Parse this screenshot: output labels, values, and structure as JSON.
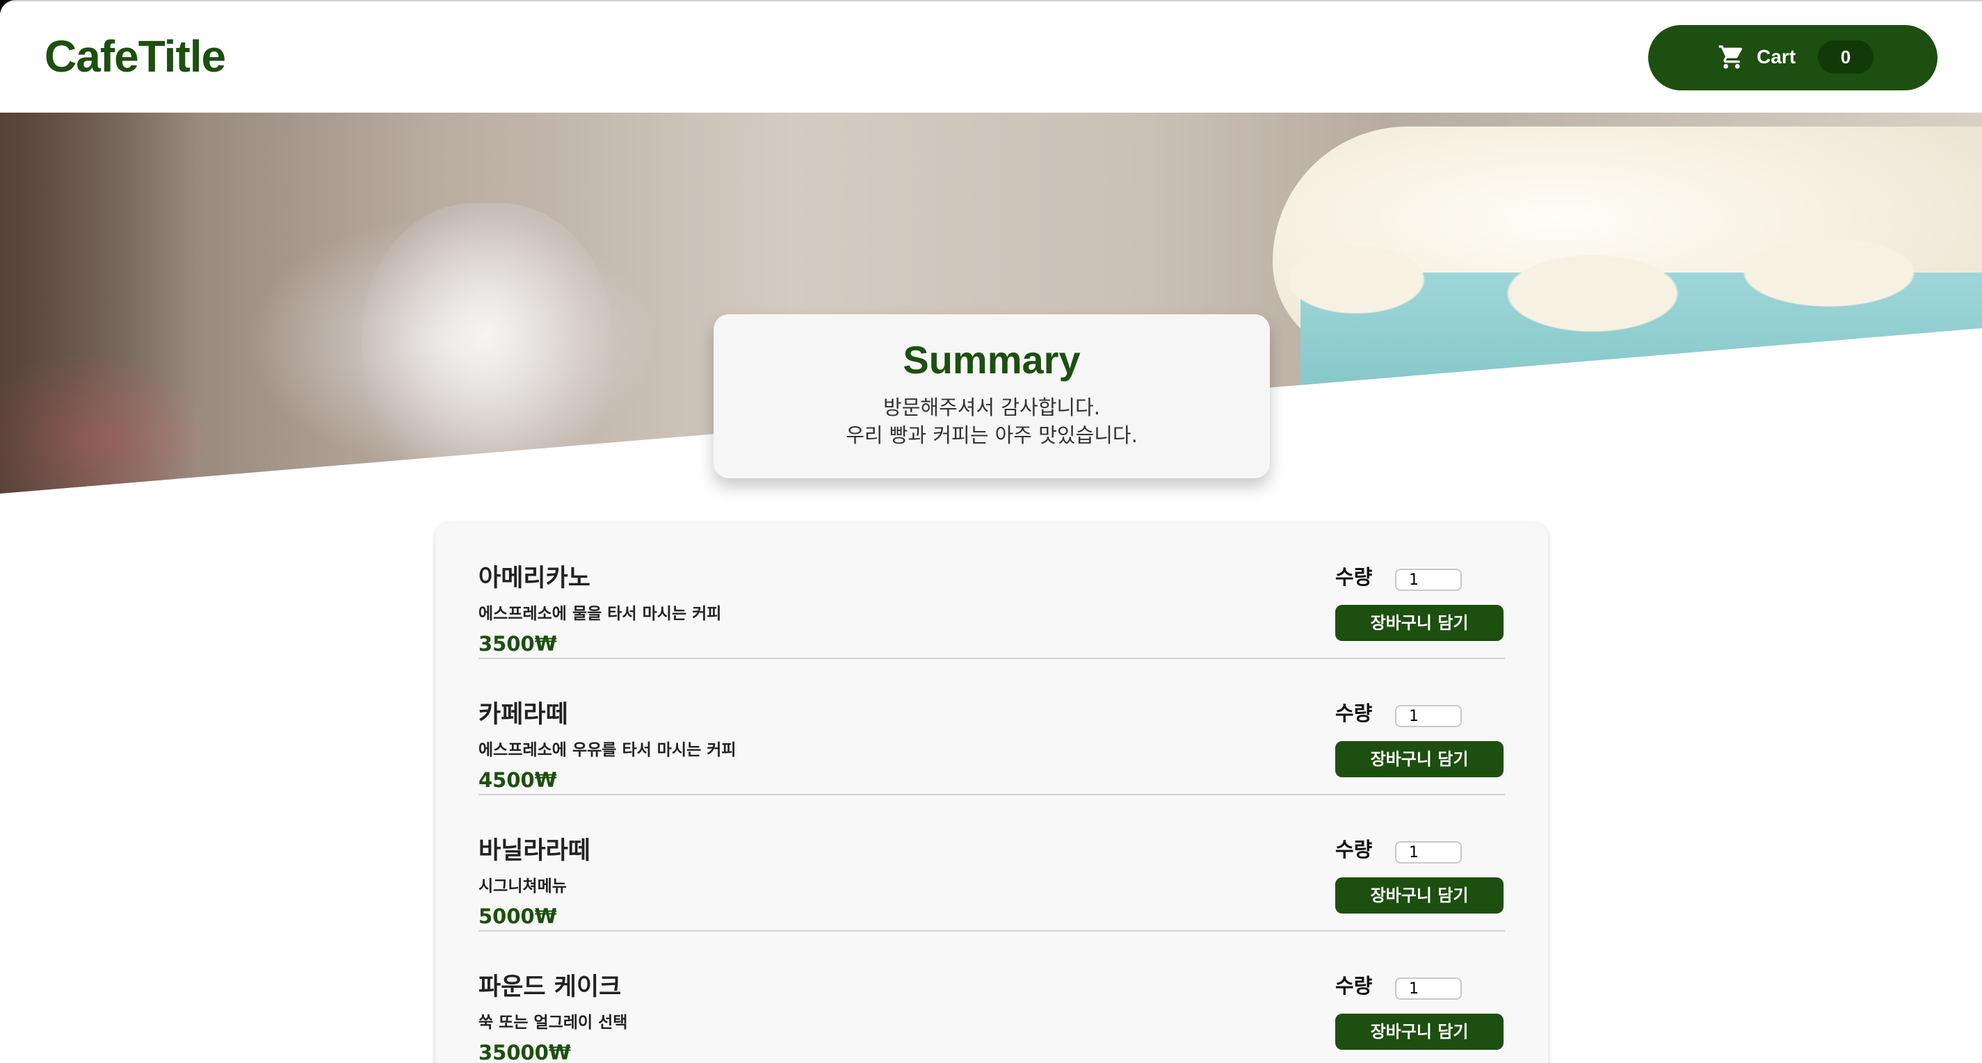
{
  "header": {
    "logo": "CafeTitle",
    "cart_label": "Cart",
    "cart_count": "0"
  },
  "summary": {
    "title": "Summary",
    "line1": "방문해주셔서 감사합니다.",
    "line2": "우리 빵과 커피는 아주 맛있습니다."
  },
  "menu": {
    "items": [
      {
        "name": "아메리카노",
        "description": "에스프레소에 물을 타서 마시는 커피",
        "price": "3500₩",
        "qty_label": "수량",
        "qty_value": "1",
        "button": "장바구니 담기"
      },
      {
        "name": "카페라떼",
        "description": "에스프레소에 우유를 타서 마시는 커피",
        "price": "4500₩",
        "qty_label": "수량",
        "qty_value": "1",
        "button": "장바구니 담기"
      },
      {
        "name": "바닐라라떼",
        "description": "시그니쳐메뉴",
        "price": "5000₩",
        "qty_label": "수량",
        "qty_value": "1",
        "button": "장바구니 담기"
      },
      {
        "name": "파운드 케이크",
        "description": "쑥 또는 얼그레이 선택",
        "price": "35000₩",
        "qty_label": "수량",
        "qty_value": "1",
        "button": "장바구니 담기"
      }
    ]
  },
  "colors": {
    "brand_green": "#1d4f10",
    "card_background": "#f8f8f8"
  },
  "icons": {
    "cart": "shopping-cart-icon"
  }
}
